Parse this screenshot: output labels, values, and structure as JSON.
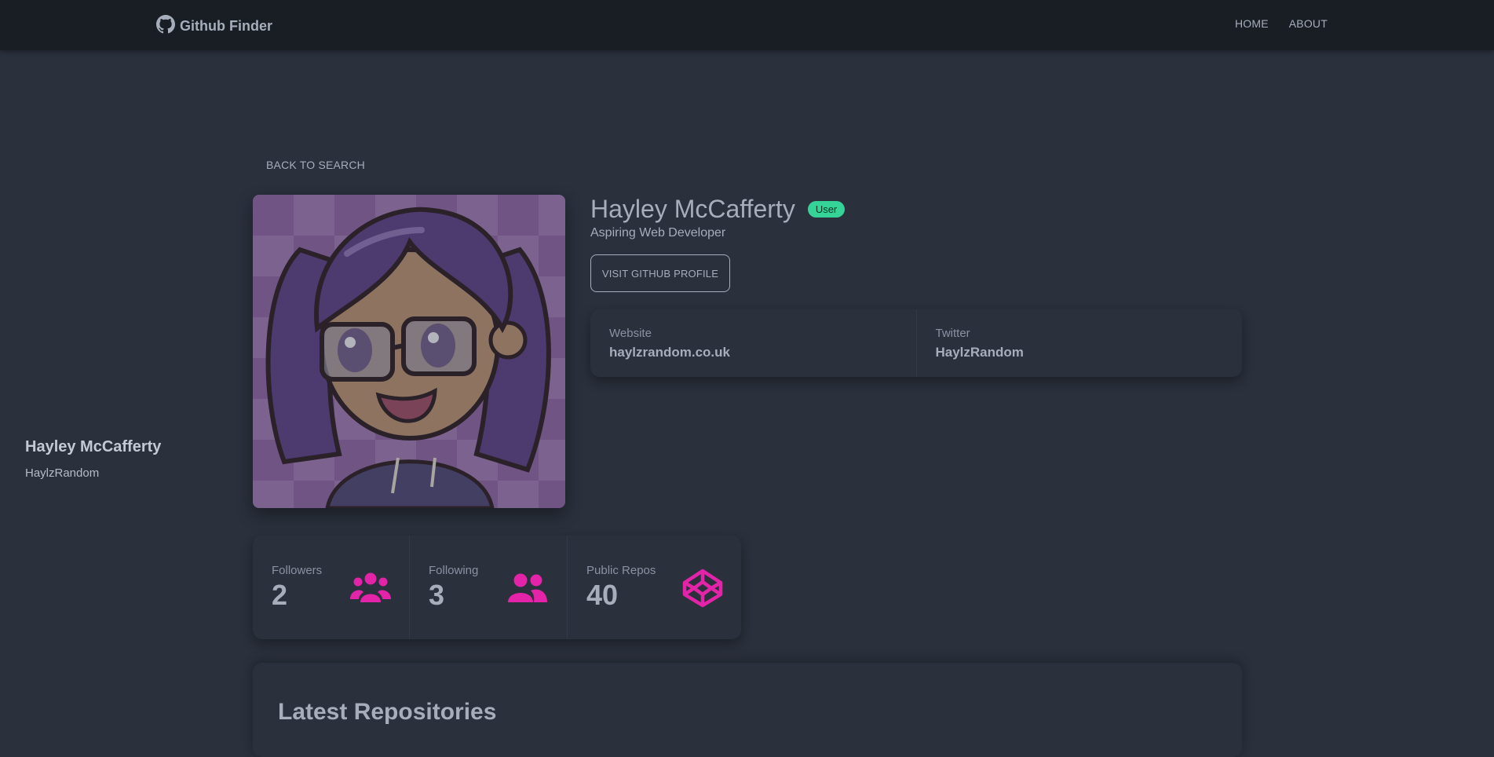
{
  "app": {
    "title": "Github Finder"
  },
  "nav": {
    "home": "HOME",
    "about": "ABOUT"
  },
  "back_label": "BACK TO SEARCH",
  "user": {
    "name": "Hayley McCafferty",
    "login": "HaylzRandom",
    "type": "User",
    "bio": "Aspiring Web Developer",
    "visit_label": "VISIT GITHUB PROFILE",
    "website_label": "Website",
    "website": "haylzrandom.co.uk",
    "twitter_label": "Twitter",
    "twitter": "HaylzRandom"
  },
  "stats": {
    "followers_label": "Followers",
    "followers": "2",
    "following_label": "Following",
    "following": "3",
    "repos_label": "Public Repos",
    "repos": "40"
  },
  "repos_section": {
    "title": "Latest Repositories"
  },
  "colors": {
    "accent_pink": "#e424a8",
    "badge_green": "#36d399",
    "navbar": "#191d24",
    "background": "#2a303c"
  },
  "icons": {
    "brand": "github-icon",
    "followers": "users-icon",
    "following": "user-friends-icon",
    "repos": "codepen-icon"
  }
}
